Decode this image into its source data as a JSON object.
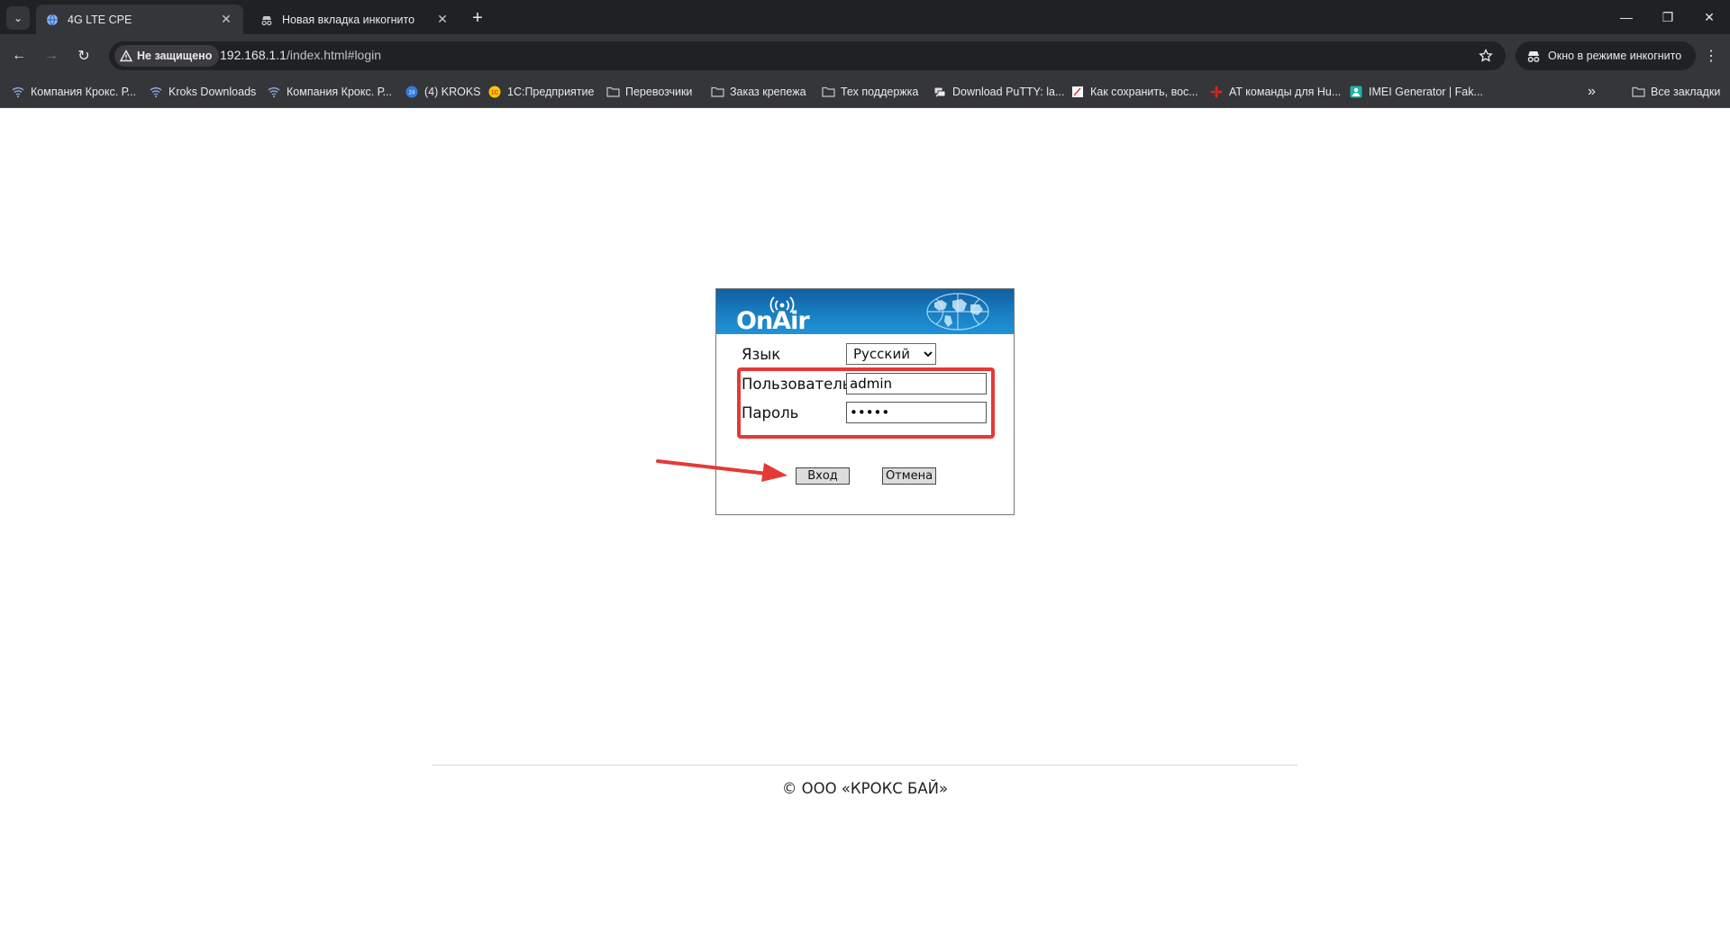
{
  "browser": {
    "tabs": [
      {
        "title": "4G LTE CPE",
        "active": true
      },
      {
        "title": "Новая вкладка инкогнито",
        "active": false
      }
    ],
    "new_tab_symbol": "+",
    "security_label": "Не защищено",
    "url_host": "192.168.1.1",
    "url_path": "/index.html#login",
    "incognito_label": "Окно в режиме инкогнито",
    "bookmarks": [
      {
        "label": "Компания Крокс. Р...",
        "icon": "wifi-icon"
      },
      {
        "label": "Kroks Downloads",
        "icon": "wifi-icon"
      },
      {
        "label": "Компания Крокс. Р...",
        "icon": "wifi-icon"
      },
      {
        "label": "(4) KROKS",
        "icon": "bitrix24-icon"
      },
      {
        "label": "1С:Предприятие",
        "icon": "1c-icon"
      },
      {
        "label": "Перевозчики",
        "icon": "folder-icon"
      },
      {
        "label": "Заказ крепежа",
        "icon": "folder-icon"
      },
      {
        "label": "Тех поддержка",
        "icon": "folder-icon"
      },
      {
        "label": "Download PuTTY: la...",
        "icon": "putty-icon"
      },
      {
        "label": "Как сохранить, вос...",
        "icon": "page-icon"
      },
      {
        "label": "AT команды для Hu...",
        "icon": "huawei-icon"
      },
      {
        "label": "IMEI Generator | Fak...",
        "icon": "imei-icon"
      }
    ],
    "more_bookmarks_symbol": "»",
    "all_bookmarks_label": "Все закладки"
  },
  "login": {
    "logo_text": "OnAir",
    "language_label": "Язык",
    "language_selected": "Русский",
    "user_label": "Пользователь",
    "user_value": "admin",
    "password_label": "Пароль",
    "password_value": "admin",
    "login_button": "Вход",
    "cancel_button": "Отмена"
  },
  "footer": {
    "copyright": "© ООО «КРОКС БАЙ»"
  },
  "colors": {
    "annotation_red": "#e53935",
    "header_blue": "#1a82c6",
    "chrome_dark": "#202124",
    "chrome_toolbar": "#35363a"
  }
}
